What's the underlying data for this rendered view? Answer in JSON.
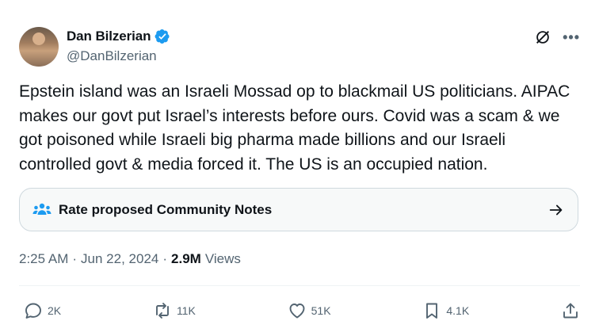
{
  "author": {
    "display_name": "Dan Bilzerian",
    "handle": "@DanBilzerian",
    "verified": true,
    "verified_color": "#1d9bf0"
  },
  "tweet": {
    "text": "Epstein island was an Israeli Mossad op to blackmail US politicians. AIPAC makes our govt put Israel’s interests before ours. Covid was a scam & we got poisoned while Israeli big pharma made billions and our Israeli controlled govt & media forced it. The US is an occupied nation."
  },
  "community_notes": {
    "label": "Rate proposed Community Notes",
    "icon": "people-icon",
    "icon_color": "#1d9bf0"
  },
  "meta": {
    "time": "2:25 AM",
    "dot": "·",
    "date": "Jun 22, 2024",
    "views_count": "2.9M",
    "views_label": "Views"
  },
  "actions": {
    "replies": "2K",
    "reposts": "11K",
    "likes": "51K",
    "bookmarks": "4.1K"
  },
  "colors": {
    "text": "#0f1419",
    "secondary": "#536471",
    "border": "#cfd9de"
  }
}
